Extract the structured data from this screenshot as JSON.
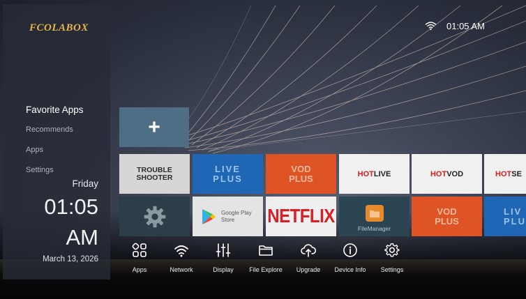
{
  "brand": {
    "logo_text": "FCOLABOX"
  },
  "status_bar": {
    "wifi_icon": "wifi-icon",
    "time": "01:05 AM"
  },
  "sidebar": {
    "items": [
      {
        "label": "Favorite Apps",
        "active": true
      },
      {
        "label": "Recommends",
        "active": false
      },
      {
        "label": "Apps",
        "active": false
      },
      {
        "label": "Settings",
        "active": false
      }
    ],
    "clock": {
      "day": "Friday",
      "time": "01:05",
      "ampm": "AM",
      "date": "March 13, 2026"
    }
  },
  "favorites": {
    "add_icon": "plus-icon",
    "row1": [
      {
        "name": "trouble-shooter",
        "line1": "TROUBLE",
        "line2": "SHOOTER",
        "bg": "#d6d6d6"
      },
      {
        "name": "live-plus",
        "line1": "LIVE",
        "line2": "PLUS",
        "bg": "#1f66b4"
      },
      {
        "name": "vod-plus",
        "line1": "VOD",
        "line2": "PLUS",
        "bg": "#df5424"
      },
      {
        "name": "hot-live",
        "prefix": "HOT",
        "suffix": "LIVE",
        "bg": "#f0f0f0"
      },
      {
        "name": "hot-vod",
        "prefix": "HOT",
        "suffix": "VOD",
        "bg": "#f0f0f0"
      },
      {
        "name": "hot-se",
        "prefix": "HOT",
        "suffix": "SE",
        "bg": "#f0f0f0"
      }
    ],
    "row2": [
      {
        "name": "system-settings",
        "icon": "gear-icon",
        "bg": "#2c3e48"
      },
      {
        "name": "google-play-store",
        "icon": "google-play-icon",
        "line1": "Google Play",
        "line2": "Store",
        "bg": "#e4e4e4"
      },
      {
        "name": "netflix",
        "label": "NETFLIX",
        "color": "#d81f26",
        "bg": "#efefef"
      },
      {
        "name": "file-manager",
        "icon": "folder-icon",
        "label": "FileManager",
        "bg": "#2b4553"
      },
      {
        "name": "vod-plus",
        "line1": "VOD",
        "line2": "PLUS",
        "bg": "#df5424"
      },
      {
        "name": "live-plus",
        "line1": "LIV",
        "line2": "PLU",
        "bg": "#1f66b4"
      }
    ]
  },
  "dock": [
    {
      "label": "Apps",
      "icon": "apps-grid-icon"
    },
    {
      "label": "Network",
      "icon": "wifi-icon"
    },
    {
      "label": "Display",
      "icon": "sliders-icon"
    },
    {
      "label": "File Explore",
      "icon": "folder-icon"
    },
    {
      "label": "Upgrade",
      "icon": "cloud-upload-icon"
    },
    {
      "label": "Device Info",
      "icon": "info-icon"
    },
    {
      "label": "Settings",
      "icon": "gear-icon"
    }
  ],
  "colors": {
    "brand_gold": "#e4b54a",
    "accent_tile": "#4e6e86",
    "hot_red": "#d42020"
  }
}
